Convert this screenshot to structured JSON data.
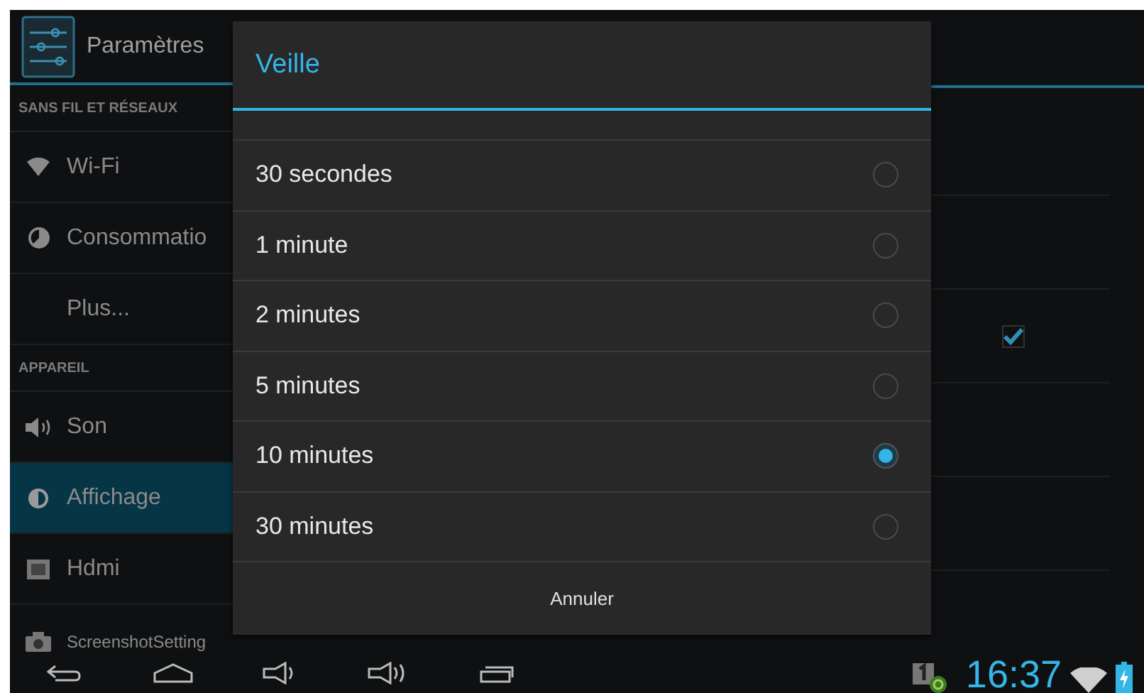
{
  "action_bar": {
    "title": "Paramètres"
  },
  "sidebar": {
    "items": [
      {
        "kind": "header",
        "label": "SANS FIL ET RÉSEAUX"
      },
      {
        "kind": "item",
        "label": "Wi-Fi",
        "selected": false
      },
      {
        "kind": "item",
        "label": "Consommatio",
        "selected": false
      },
      {
        "kind": "item",
        "label": "Plus...",
        "selected": false
      },
      {
        "kind": "header",
        "label": "APPAREIL"
      },
      {
        "kind": "item",
        "label": "Son",
        "selected": false
      },
      {
        "kind": "item",
        "label": "Affichage",
        "selected": true
      },
      {
        "kind": "item",
        "label": "Hdmi",
        "selected": false
      },
      {
        "kind": "item",
        "label": "ScreenshotSetting",
        "selected": false
      }
    ]
  },
  "detail": {
    "checkbox": {
      "checked": true
    }
  },
  "dialog": {
    "title": "Veille",
    "options": [
      {
        "label": "30 secondes",
        "selected": false
      },
      {
        "label": "1 minute",
        "selected": false
      },
      {
        "label": "2 minutes",
        "selected": false
      },
      {
        "label": "5 minutes",
        "selected": false
      },
      {
        "label": "10 minutes",
        "selected": true
      },
      {
        "label": "30 minutes",
        "selected": false
      }
    ],
    "cancel": "Annuler"
  },
  "status_bar": {
    "clock": "16:37"
  }
}
